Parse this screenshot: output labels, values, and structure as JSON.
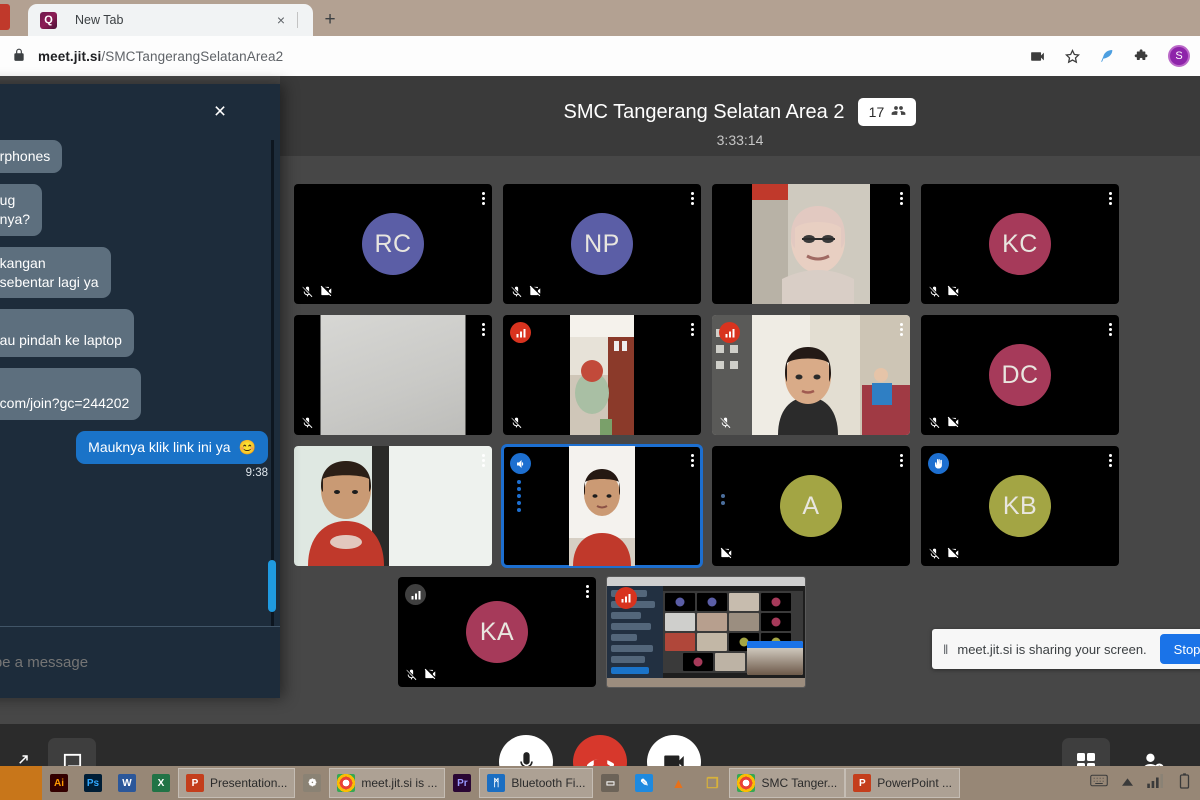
{
  "browser": {
    "tab": {
      "title": "New Tab",
      "favicon_letter": "Q",
      "close_label": "×",
      "new_tab_label": "+"
    },
    "omnibox": {
      "url_host": "meet.jit.si",
      "url_path": "/SMCTangerangSelatanArea2",
      "lock_icon": "lock-icon",
      "actions": [
        "screen-cast-icon",
        "bookmark-star-icon",
        "feather-icon",
        "extensions-puzzle-icon"
      ],
      "profile_initial": "S"
    }
  },
  "meeting": {
    "title": "SMC Tangerang Selatan Area 2",
    "participant_count": "17",
    "participants_icon": "people-icon",
    "timer": "3:33:14",
    "tiles": [
      {
        "id": "rc",
        "label": "RC",
        "kind": "avatar",
        "avatar_color": "#5b5ea6",
        "muted": true,
        "camera_off": true
      },
      {
        "id": "np",
        "label": "NP",
        "kind": "avatar",
        "avatar_color": "#5b5ea6",
        "muted": true,
        "camera_off": true
      },
      {
        "id": "hijab",
        "label": "",
        "kind": "video",
        "video_class": "v-hijab",
        "muted": false,
        "camera_off": false
      },
      {
        "id": "kc",
        "label": "KC",
        "kind": "avatar",
        "avatar_color": "#a63a5a",
        "muted": true,
        "camera_off": true
      },
      {
        "id": "grey",
        "label": "",
        "kind": "video",
        "video_class": "v-grey",
        "muted": true,
        "camera_off": false
      },
      {
        "id": "room1",
        "label": "",
        "kind": "video",
        "video_class": "v-room1",
        "muted": true,
        "camera_off": false,
        "connection": "red"
      },
      {
        "id": "girl",
        "label": "",
        "kind": "video",
        "video_class": "v-room2",
        "muted": true,
        "camera_off": false,
        "connection": "red"
      },
      {
        "id": "dc",
        "label": "DC",
        "kind": "avatar",
        "avatar_color": "#a63a5a",
        "muted": true,
        "camera_off": true
      },
      {
        "id": "boy-red",
        "label": "",
        "kind": "video",
        "video_class": "v-kid1",
        "muted": false,
        "camera_off": false
      },
      {
        "id": "active-speaker",
        "label": "",
        "kind": "video",
        "video_class": "v-kid2",
        "active": true,
        "connection": "blue",
        "muted": false,
        "camera_off": false
      },
      {
        "id": "a",
        "label": "A",
        "kind": "avatar",
        "avatar_color": "#a3a544",
        "muted": false,
        "camera_off": true
      },
      {
        "id": "kb",
        "label": "KB",
        "kind": "avatar",
        "avatar_color": "#a3a544",
        "muted": true,
        "camera_off": true,
        "connection": "blue"
      },
      {
        "id": "ka",
        "label": "KA",
        "kind": "avatar",
        "avatar_color": "#a63a5a",
        "muted": true,
        "camera_off": true,
        "connection": "grey"
      },
      {
        "id": "screenshare",
        "label": "",
        "kind": "screenshare",
        "connection": "red"
      }
    ],
    "toolbar": {
      "mic_label": "microphone-button",
      "hangup_label": "hangup-button",
      "camera_label": "camera-button",
      "tile_view_label": "tile-view-button",
      "invite_label": "invite-people-button",
      "chat_label": "chat-button"
    }
  },
  "share_notification": {
    "pause_glyph": "‖",
    "text": "meet.jit.si is sharing your screen.",
    "stop_label": "Stop sharing"
  },
  "chat": {
    "close_label": "×",
    "messages": [
      {
        "dir": "in",
        "text": "...rphones"
      },
      {
        "dir": "in",
        "text": "...ug\n...nya?"
      },
      {
        "dir": "in",
        "text": "...kangan\n...sebentar lagi ya"
      },
      {
        "dir": "in",
        "text": "...au pindah ke laptop"
      },
      {
        "dir": "in",
        "text": "...com/join?gc=244202"
      },
      {
        "dir": "out",
        "text": "Mauknya klik link ini ya",
        "emoji": "😊",
        "time": "9:38"
      }
    ],
    "input_placeholder": "Type a message"
  },
  "taskbar": {
    "items": [
      {
        "name": "illustrator",
        "label": "",
        "glyph": "Ai",
        "color": "#4a2c06",
        "framed": false
      },
      {
        "name": "photoshop",
        "label": "",
        "glyph": "Ps",
        "color": "#001e36",
        "framed": false
      },
      {
        "name": "word",
        "label": "",
        "glyph": "W",
        "color": "#2b579a",
        "framed": false
      },
      {
        "name": "excel",
        "label": "",
        "glyph": "X",
        "color": "#217346",
        "framed": false
      },
      {
        "name": "powerpoint-presentation",
        "label": "Presentation...",
        "glyph": "P",
        "color": "#c43e1c",
        "framed": true
      },
      {
        "name": "paint-app",
        "label": "",
        "glyph": "❁",
        "color": "#8a8274",
        "framed": false
      },
      {
        "name": "chrome-meet",
        "label": "meet.jit.si is ...",
        "glyph": "◉",
        "color": "#e8e8e8",
        "framed": true
      },
      {
        "name": "premiere",
        "label": "",
        "glyph": "Pr",
        "color": "#2a0634",
        "framed": false
      },
      {
        "name": "bluetooth-file",
        "label": "Bluetooth Fi...",
        "glyph": "ᛗ",
        "color": "#1b6ec2",
        "framed": true
      },
      {
        "name": "usb-device",
        "label": "",
        "glyph": "▭",
        "color": "#6c6358",
        "framed": false
      },
      {
        "name": "editor-app",
        "label": "",
        "glyph": "✎",
        "color": "#1e8ae0",
        "framed": false
      },
      {
        "name": "vlc-player",
        "label": "",
        "glyph": "▲",
        "color": "#e8711a",
        "framed": false
      },
      {
        "name": "files-app",
        "label": "",
        "glyph": "❐",
        "color": "#d8b23a",
        "framed": false
      },
      {
        "name": "chrome-smc",
        "label": "SMC Tanger...",
        "glyph": "◉",
        "color": "#e8e8e8",
        "framed": true
      },
      {
        "name": "powerpoint-pdf",
        "label": "PowerPoint ...",
        "glyph": "■",
        "color": "#c43e1c",
        "framed": true
      }
    ],
    "tray": [
      "keyboard-icon",
      "show-hidden-icons-icon",
      "network-signal-icon",
      "battery-icon"
    ]
  }
}
